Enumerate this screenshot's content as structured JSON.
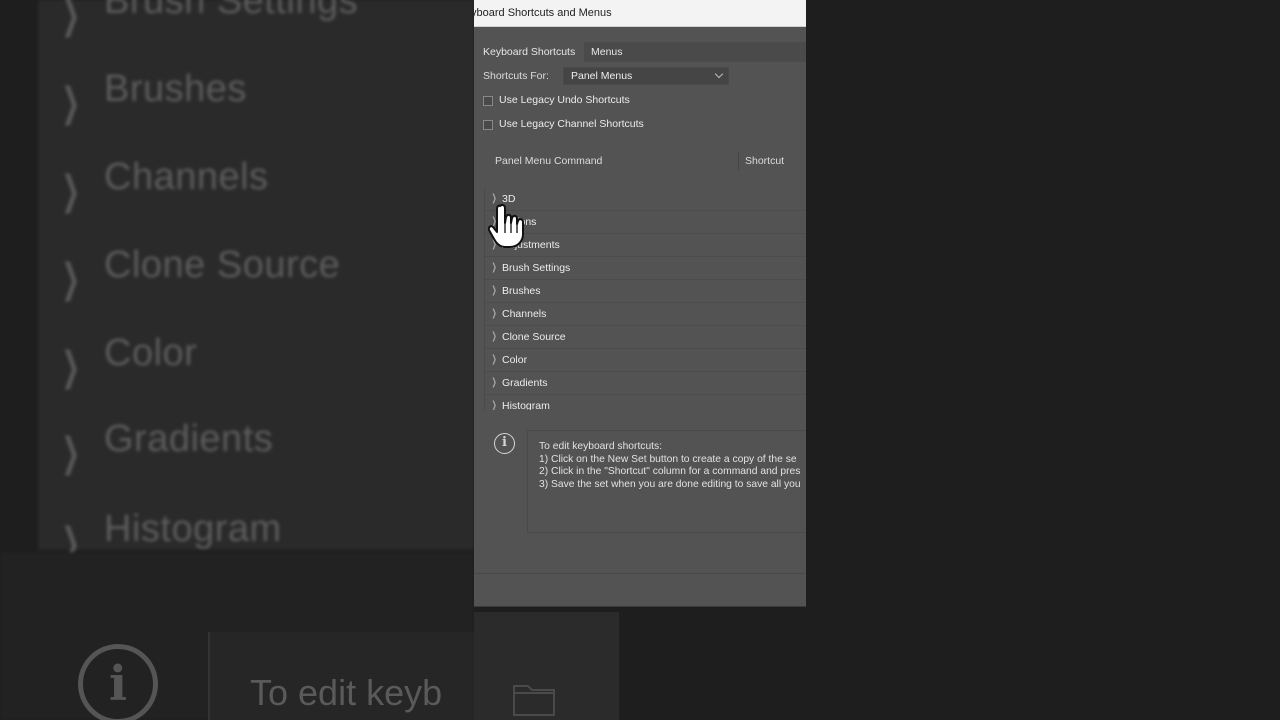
{
  "background": {
    "items": [
      "Brush Settings",
      "Brushes",
      "Channels",
      "Clone Source",
      "Color",
      "Gradients",
      "Histogram"
    ],
    "info_text": "To edit keyb"
  },
  "dialog": {
    "title": "yboard Shortcuts and Menus",
    "tabs": [
      "Keyboard Shortcuts",
      "Menus"
    ],
    "shortcuts_for_label": "Shortcuts For:",
    "shortcuts_for_value": "Panel Menus",
    "checkboxes": [
      {
        "label": "Use Legacy Undo Shortcuts",
        "checked": false
      },
      {
        "label": "Use Legacy Channel Shortcuts",
        "checked": false
      }
    ],
    "columns": {
      "command": "Panel Menu Command",
      "shortcut": "Shortcut"
    },
    "items": [
      "3D",
      "Actions",
      "Adjustments",
      "Brush Settings",
      "Brushes",
      "Channels",
      "Clone Source",
      "Color",
      "Gradients",
      "Histogram"
    ],
    "info": [
      "To edit keyboard shortcuts:",
      "1) Click on the New Set button to create a copy of the se",
      "2) Click in the \"Shortcut\" column for a command and pres",
      "3) Save the set when you are done editing to save all you"
    ]
  },
  "icons": {
    "info": "info-icon",
    "folder": "folder-icon",
    "cursor": "hand-pointer-icon"
  },
  "colors": {
    "dialog_bg": "#535353",
    "titlebar_bg": "#f3f3f3",
    "backdrop": "#1e1e1e"
  }
}
